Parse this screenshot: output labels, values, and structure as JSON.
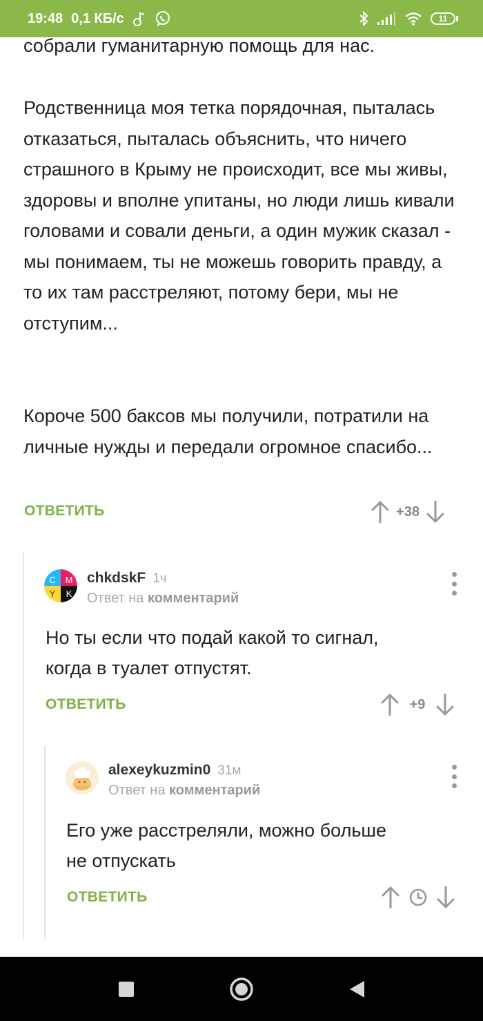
{
  "status_bar": {
    "time": "19:48",
    "speed": "0,1 КБ/с",
    "battery": "11",
    "icons": [
      "music-note-icon",
      "whatsapp-icon",
      "bluetooth-icon",
      "signal-icon",
      "wifi-icon",
      "battery-icon"
    ]
  },
  "post": {
    "paragraph_partial": "собрали гуманитарную помощь для нас.",
    "paragraph_2": "Родственница моя тетка порядочная, пыталась отказаться, пыталась объяснить, что ничего страшного в Крыму не происходит, все мы живы, здоровы и вполне упитаны, но люди лишь кивали головами и совали деньги, а один мужик сказал - мы понимаем, ты не можешь говорить правду, а то их там расстреляют, потому бери, мы не отступим...",
    "paragraph_3": "Короче 500 баксов мы получили, потратили на личные нужды и передали огромное спасибо...",
    "reply_label": "ОТВЕТИТЬ",
    "rating": "+38"
  },
  "comments": [
    {
      "author": "chkdskF",
      "time": "1ч",
      "reply_to_prefix": "Ответ на",
      "reply_to_target": "комментарий",
      "text_line_1": "Но ты если что подай какой то сигнал,",
      "text_line_2": "когда в туалет отпустят.",
      "reply_label": "ОТВЕТИТЬ",
      "rating": "+9",
      "avatar_letters": [
        "C",
        "M",
        "Y",
        "K"
      ]
    },
    {
      "author": "alexeykuzmin0",
      "time": "31м",
      "reply_to_prefix": "Ответ на",
      "reply_to_target": "комментарий",
      "text_line_1": "Его уже расстреляли, можно больше",
      "text_line_2": "не отпускать",
      "reply_label": "ОТВЕТИТЬ",
      "rating_state": "pending"
    }
  ],
  "colors": {
    "status_bar": "#8ab94a",
    "accent": "#7cb342",
    "nav_bar": "#000000"
  },
  "nav_bar": {
    "buttons": [
      "recent-apps-icon",
      "home-icon",
      "back-icon"
    ]
  }
}
